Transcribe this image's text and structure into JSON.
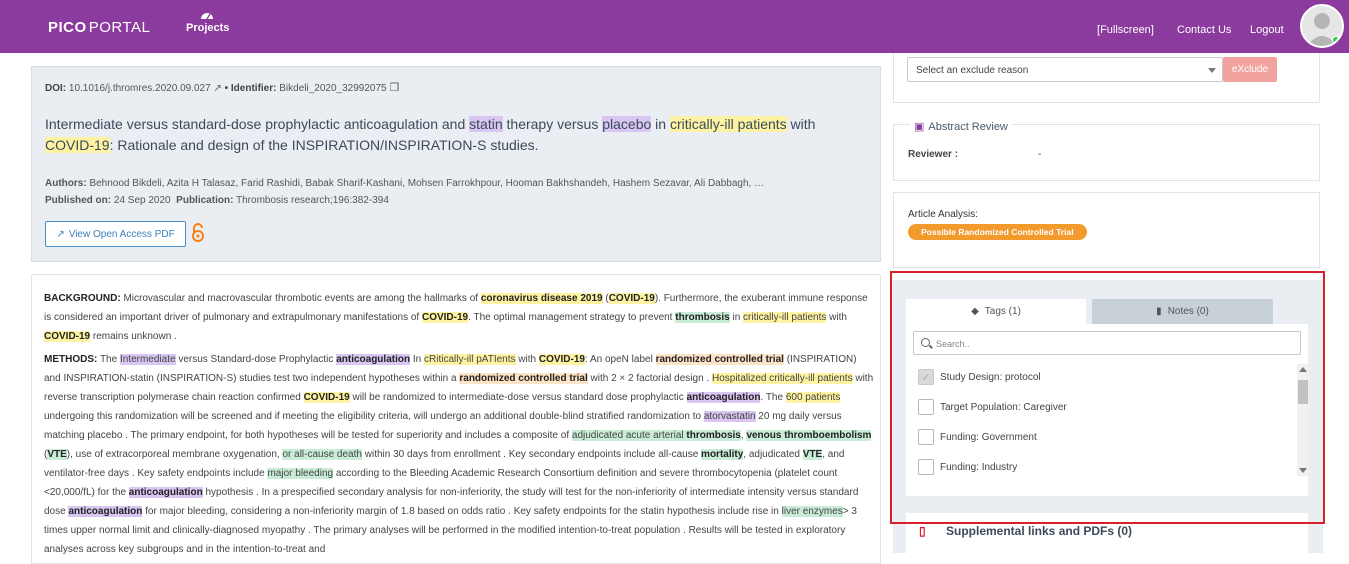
{
  "header": {
    "logo_left": "PICO",
    "logo_right": "PORTAL",
    "nav_projects": "Projects",
    "fullscreen": "Fullscreen",
    "contact": "Contact Us",
    "logout": "Logout"
  },
  "article": {
    "doi_label": "DOI:",
    "doi_value": "10.1016/j.thromres.2020.09.027",
    "identifier_label": "• Identifier:",
    "identifier_value": "Bikdeli_2020_32992075",
    "title_parts": [
      "Intermediate versus standard-dose prophylactic anticoagulation and ",
      "statin",
      " therapy versus ",
      "placebo",
      " in ",
      "critically-ill patients",
      " with ",
      "COVID-19",
      ": Rationale and design of the INSPIRATION/INSPIRATION-S studies."
    ],
    "authors_label": "Authors:",
    "authors_value": "Behnood Bikdeli, Azita H Talasaz, Farid Rashidi, Babak Sharif-Kashani, Mohsen Farrokhpour, Hooman Bakhshandeh, Hashem Sezavar, Ali Dabbagh, …",
    "published_label": "Published on:",
    "published_value": "24 Sep 2020",
    "publication_label": "Publication:",
    "publication_value": "Thrombosis research;196:382-394",
    "pdf_button": "View Open Access PDF"
  },
  "abstract": {
    "background_label": "BACKGROUND:",
    "methods_label": "METHODS:"
  },
  "exclude": {
    "select_placeholder": "Select an exclude reason",
    "button": "eXclude"
  },
  "review": {
    "heading": "Abstract Review",
    "reviewer_label": "Reviewer :",
    "reviewer_value": "-"
  },
  "analysis": {
    "label": "Article Analysis:",
    "badge": "Possible Randomized Controlled Trial"
  },
  "tags_panel": {
    "tab_tags": "Tags (1)",
    "tab_notes": "Notes (0)",
    "search_placeholder": "Search..",
    "items": [
      {
        "label": "Study Design: protocol",
        "checked": true
      },
      {
        "label": "Target Population: Caregiver",
        "checked": false
      },
      {
        "label": "Funding: Government",
        "checked": false
      },
      {
        "label": "Funding: Industry",
        "checked": false
      }
    ]
  },
  "supplemental": {
    "label": "Supplemental links and PDFs (0)"
  },
  "colors": {
    "brand": "#8b3a9e",
    "highlight_red": "#d8202a",
    "badge_orange": "#f39a2c"
  }
}
